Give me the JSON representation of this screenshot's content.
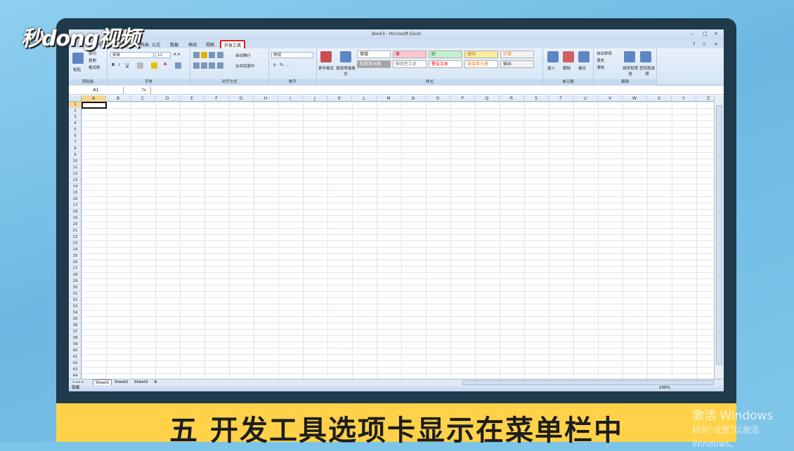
{
  "logo": {
    "text": "秒dong视频"
  },
  "caption": "五 开发工具选项卡显示在菜单栏中",
  "watermark": {
    "line1": "激活 Windows",
    "line2": "转到\"设置\"以激活 Windows。"
  },
  "excel": {
    "title": "Book3 - Microsoft Excel",
    "tabs": [
      {
        "label": "开始"
      },
      {
        "label": "插入"
      },
      {
        "label": "页面布局"
      },
      {
        "label": "公式"
      },
      {
        "label": "数据"
      },
      {
        "label": "审阅"
      },
      {
        "label": "视图"
      },
      {
        "label": "开发工具",
        "highlighted": true
      }
    ],
    "ribbon": {
      "clipboard": {
        "paste": "粘贴",
        "cut": "剪切",
        "copy": "复制",
        "format_painter": "格式刷",
        "label": "剪贴板"
      },
      "font": {
        "name": "宋体",
        "size": "11",
        "label": "字体"
      },
      "alignment": {
        "wrap": "自动换行",
        "merge": "合并后居中",
        "label": "对齐方式"
      },
      "number": {
        "format": "常规",
        "label": "数字"
      },
      "styles": {
        "cond": "条件格式",
        "table": "套用表格格式",
        "label": "样式",
        "cells": [
          {
            "text": "常规",
            "bg": "#ffffff",
            "color": "#000000"
          },
          {
            "text": "差",
            "bg": "#ffc7ce",
            "color": "#9c0006"
          },
          {
            "text": "好",
            "bg": "#c6efce",
            "color": "#006100"
          },
          {
            "text": "适中",
            "bg": "#ffeb9c",
            "color": "#9c6500"
          },
          {
            "text": "计算",
            "bg": "#f2f2f2",
            "color": "#fa7d00"
          },
          {
            "text": "检查单元格",
            "bg": "#a5a5a5",
            "color": "#ffffff"
          },
          {
            "text": "解释性文本",
            "bg": "#ffffff",
            "color": "#7f7f7f"
          },
          {
            "text": "警告文本",
            "bg": "#ffffff",
            "color": "#ff0000"
          },
          {
            "text": "链接单元格",
            "bg": "#ffffff",
            "color": "#fa7d00"
          },
          {
            "text": "输出",
            "bg": "#f2f2f2",
            "color": "#3f3f3f"
          }
        ]
      },
      "cells": {
        "insert": "插入",
        "delete": "删除",
        "format": "格式",
        "label": "单元格"
      },
      "editing": {
        "autosum": "自动求和",
        "fill": "填充",
        "clear": "清除",
        "sort": "排序和筛选",
        "find": "查找和选择",
        "label": "编辑"
      }
    },
    "namebox": "A1",
    "fx": "fx",
    "columns": [
      "A",
      "B",
      "C",
      "D",
      "E",
      "F",
      "G",
      "H",
      "I",
      "J",
      "K",
      "L",
      "M",
      "N",
      "O",
      "P",
      "Q",
      "R",
      "S",
      "T",
      "U",
      "V",
      "W",
      "X",
      "Y",
      "Z"
    ],
    "sheets": [
      "Sheet1",
      "Sheet2",
      "Sheet3"
    ],
    "status": "就绪",
    "zoom": "100%"
  }
}
